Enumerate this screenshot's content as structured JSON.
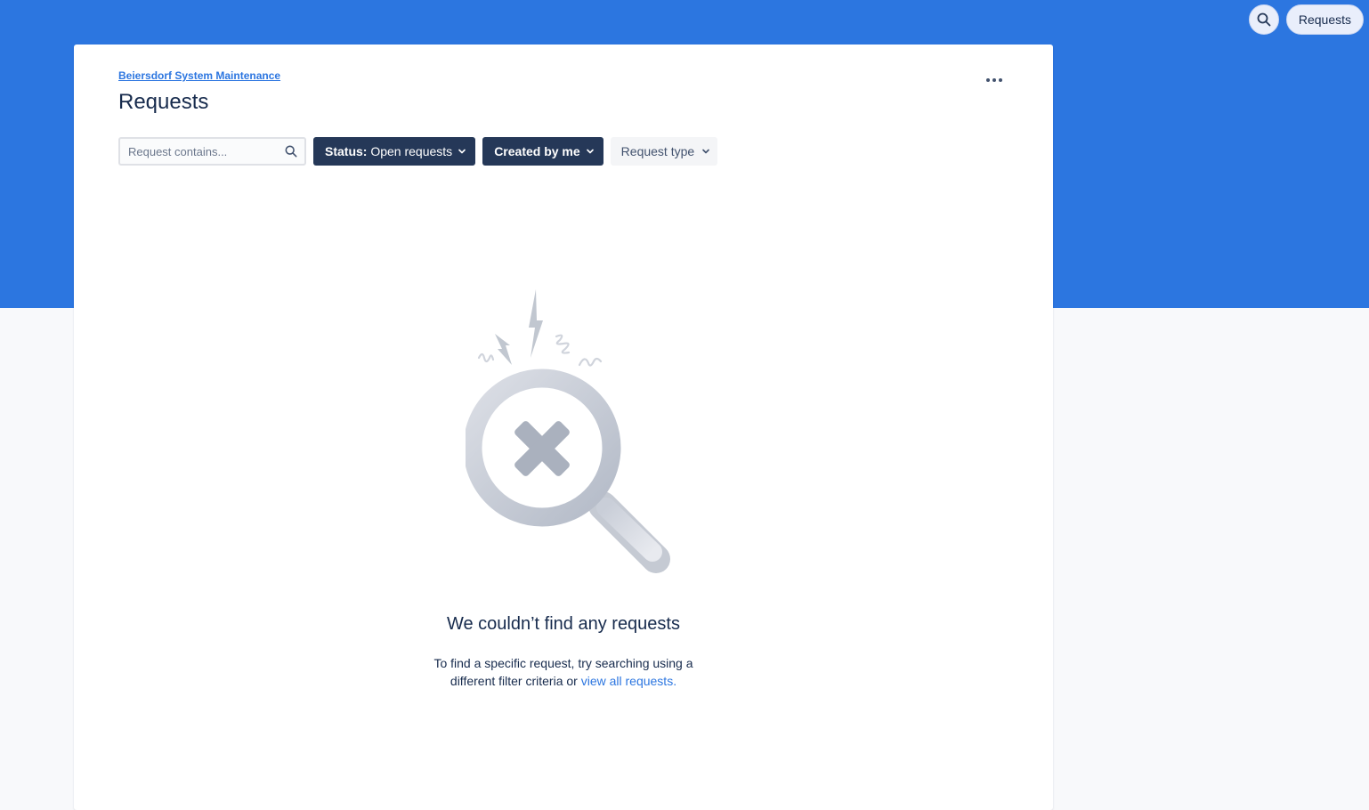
{
  "header": {
    "search_icon": "search-icon",
    "requests_button": "Requests"
  },
  "page": {
    "breadcrumb": "Beiersdorf System Maintenance",
    "title": "Requests",
    "more_icon": "more-horizontal-icon"
  },
  "filters": {
    "search_placeholder": "Request contains...",
    "search_value": "",
    "status_label": "Status:",
    "status_value": "Open requests",
    "created_by": "Created by me",
    "request_type": "Request type"
  },
  "empty_state": {
    "illustration": "magnifier-no-results-icon",
    "title": "We couldn’t find any requests",
    "description_line1": "To find a specific request, try searching using a",
    "description_line2": "different filter criteria or",
    "link_text": "view all requests",
    "period": "."
  },
  "colors": {
    "banner": "#2c76e0",
    "primary_text": "#172b4d",
    "dark_button": "#253858",
    "link": "#2c76e0"
  }
}
